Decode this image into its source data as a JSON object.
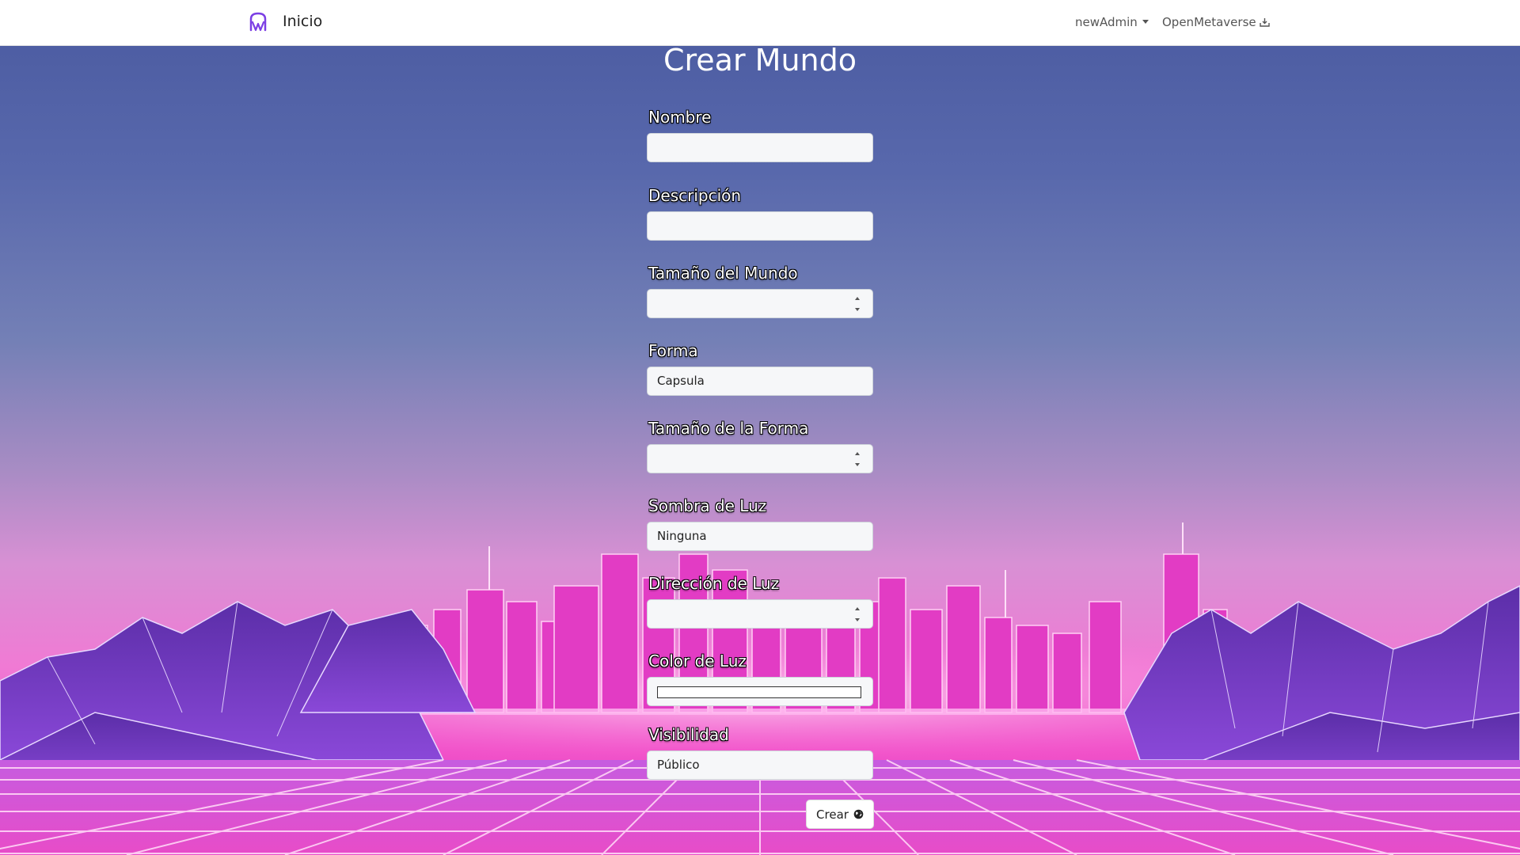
{
  "nav": {
    "brand": "Inicio",
    "user_menu": "newAdmin",
    "app_link": "OpenMetaverse",
    "brand_icon": "metaverse-m-logo",
    "download_icon": "download-icon"
  },
  "form": {
    "title": "Crear Mundo",
    "fields": {
      "nombre": {
        "label": "Nombre",
        "value": ""
      },
      "descripcion": {
        "label": "Descripción",
        "value": ""
      },
      "tamano_mundo": {
        "label": "Tamaño del Mundo",
        "value": ""
      },
      "forma": {
        "label": "Forma",
        "value": "Capsula"
      },
      "tamano_forma": {
        "label": "Tamaño de la Forma",
        "value": ""
      },
      "sombra_luz": {
        "label": "Sombra de Luz",
        "value": "Ninguna"
      },
      "direccion_luz": {
        "label": "Dirección de Luz",
        "value": ""
      },
      "color_luz": {
        "label": "Color de Luz",
        "value": "#ffffff"
      },
      "visibilidad": {
        "label": "Visibilidad",
        "value": "Público"
      }
    },
    "submit_label": "Crear",
    "submit_icon": "globe-icon"
  },
  "colors": {
    "accent": "#7b3fe4",
    "neon_pink": "#f040c8",
    "sky": "#4a5aa0"
  }
}
